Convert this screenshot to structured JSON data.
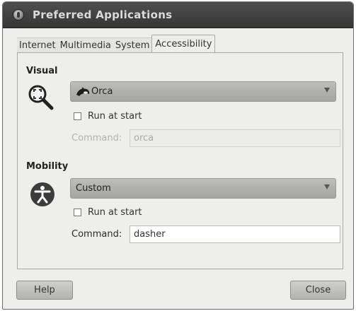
{
  "window": {
    "title": "Preferred Applications"
  },
  "tabs": [
    {
      "label": "Internet"
    },
    {
      "label": "Multimedia"
    },
    {
      "label": "System"
    },
    {
      "label": "Accessibility"
    }
  ],
  "visual": {
    "heading": "Visual",
    "app_selected": "Orca",
    "run_at_start_label": "Run at start",
    "run_at_start_checked": false,
    "command_label": "Command:",
    "command_value": "orca",
    "command_enabled": false
  },
  "mobility": {
    "heading": "Mobility",
    "app_selected": "Custom",
    "run_at_start_label": "Run at start",
    "run_at_start_checked": false,
    "command_label": "Command:",
    "command_value": "dasher",
    "command_enabled": true
  },
  "buttons": {
    "help": "Help",
    "close": "Close"
  },
  "icons": {
    "title": "preferences-icon",
    "visual": "magnifier-icon",
    "mobility": "accessibility-person-icon",
    "orca": "orca-whale-icon"
  }
}
